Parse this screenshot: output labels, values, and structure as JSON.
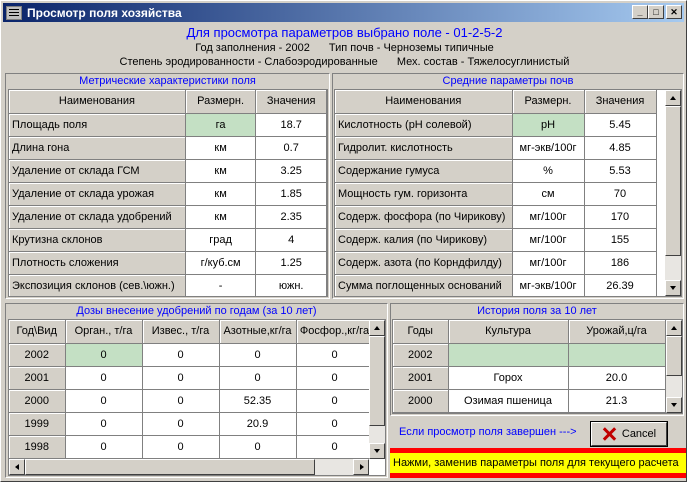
{
  "window": {
    "title": "Просмотр поля хозяйства",
    "min": "_",
    "max": "□",
    "close": "✕"
  },
  "header": {
    "line1": "Для просмотра параметров выбрано поле - 01-2-5-2",
    "year": "Год заполнения - 2002",
    "soil_type": "Тип почв - Черноземы типичные",
    "erosion": "Степень эродированности - Слабоэродированные",
    "mech": "Мех. состав - Тяжелосуглинистый"
  },
  "metric": {
    "title": "Метрические характеристики поля",
    "columns": [
      "Наименования",
      "Размерн.",
      "Значения"
    ],
    "rows": [
      [
        "Площадь поля",
        "га",
        "18.7"
      ],
      [
        "Длина гона",
        "км",
        "0.7"
      ],
      [
        "Удаление от склада ГСМ",
        "км",
        "3.25"
      ],
      [
        "Удаление от склада урожая",
        "км",
        "1.85"
      ],
      [
        "Удаление от склада удобрений",
        "км",
        "2.35"
      ],
      [
        "Крутизна склонов",
        "град",
        "4"
      ],
      [
        "Плотность сложения",
        "г/куб.см",
        "1.25"
      ],
      [
        "Экспозиция склонов (сев.\\южн.)",
        "-",
        "южн."
      ]
    ]
  },
  "soil": {
    "title": "Средние параметры почв",
    "columns": [
      "Наименования",
      "Размерн.",
      "Значения"
    ],
    "rows": [
      [
        "Кислотность (pH солевой)",
        "pH",
        "5.45"
      ],
      [
        "Гидролит. кислотность",
        "мг-экв/100г",
        "4.85"
      ],
      [
        "Содержание гумуса",
        "%",
        "5.53"
      ],
      [
        "Мощность гум. горизонта",
        "см",
        "70"
      ],
      [
        "Содерж. фосфора (по Чирикову)",
        "мг/100г",
        "170"
      ],
      [
        "Содерж. калия (по Чирикову)",
        "мг/100г",
        "155"
      ],
      [
        "Содерж. азота (по Корндфилду)",
        "мг/100г",
        "186"
      ],
      [
        "Сумма поглощенных оснований",
        "мг-экв/100г",
        "26.39"
      ]
    ]
  },
  "doses": {
    "title": "Дозы внесение удобрений по годам (за 10 лет)",
    "columns": [
      "Год\\Вид",
      "Орган., т/га",
      "Извес., т/га",
      "Азотные,кг/га",
      "Фосфор.,кг/га"
    ],
    "rows": [
      [
        "2002",
        "0",
        "0",
        "0",
        "0"
      ],
      [
        "2001",
        "0",
        "0",
        "0",
        "0"
      ],
      [
        "2000",
        "0",
        "0",
        "52.35",
        "0"
      ],
      [
        "1999",
        "0",
        "0",
        "20.9",
        "0"
      ],
      [
        "1998",
        "0",
        "0",
        "0",
        "0"
      ]
    ]
  },
  "history": {
    "title": "История поля за 10 лет",
    "columns": [
      "Годы",
      "Культура",
      "Урожай,ц/га"
    ],
    "rows": [
      [
        "2002",
        "",
        ""
      ],
      [
        "2001",
        "Горох",
        "20.0"
      ],
      [
        "2000",
        "Озимая пшеница",
        "21.3"
      ]
    ]
  },
  "footer": {
    "hint": "Если просмотр поля завершен --->",
    "cancel": "Cancel",
    "banner": "Нажми, заменив параметры поля для текущего расчета"
  },
  "colors": {
    "selected": "#c4e0c4",
    "title_blue": "#0000ff",
    "banner_yellow": "#ffff00",
    "banner_red": "#ff0000"
  }
}
